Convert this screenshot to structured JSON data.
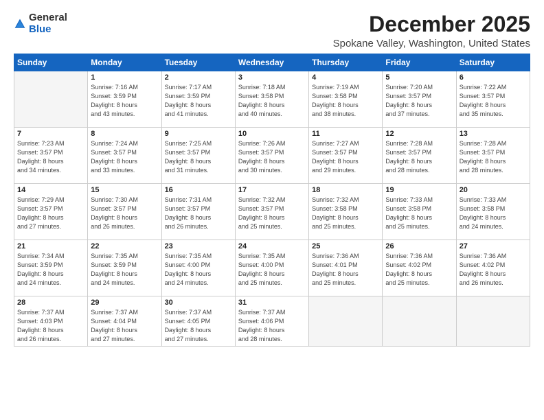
{
  "header": {
    "logo_general": "General",
    "logo_blue": "Blue",
    "month_title": "December 2025",
    "location": "Spokane Valley, Washington, United States"
  },
  "days_of_week": [
    "Sunday",
    "Monday",
    "Tuesday",
    "Wednesday",
    "Thursday",
    "Friday",
    "Saturday"
  ],
  "weeks": [
    [
      {
        "day": "",
        "info": ""
      },
      {
        "day": "1",
        "info": "Sunrise: 7:16 AM\nSunset: 3:59 PM\nDaylight: 8 hours\nand 43 minutes."
      },
      {
        "day": "2",
        "info": "Sunrise: 7:17 AM\nSunset: 3:59 PM\nDaylight: 8 hours\nand 41 minutes."
      },
      {
        "day": "3",
        "info": "Sunrise: 7:18 AM\nSunset: 3:58 PM\nDaylight: 8 hours\nand 40 minutes."
      },
      {
        "day": "4",
        "info": "Sunrise: 7:19 AM\nSunset: 3:58 PM\nDaylight: 8 hours\nand 38 minutes."
      },
      {
        "day": "5",
        "info": "Sunrise: 7:20 AM\nSunset: 3:57 PM\nDaylight: 8 hours\nand 37 minutes."
      },
      {
        "day": "6",
        "info": "Sunrise: 7:22 AM\nSunset: 3:57 PM\nDaylight: 8 hours\nand 35 minutes."
      }
    ],
    [
      {
        "day": "7",
        "info": "Sunrise: 7:23 AM\nSunset: 3:57 PM\nDaylight: 8 hours\nand 34 minutes."
      },
      {
        "day": "8",
        "info": "Sunrise: 7:24 AM\nSunset: 3:57 PM\nDaylight: 8 hours\nand 33 minutes."
      },
      {
        "day": "9",
        "info": "Sunrise: 7:25 AM\nSunset: 3:57 PM\nDaylight: 8 hours\nand 31 minutes."
      },
      {
        "day": "10",
        "info": "Sunrise: 7:26 AM\nSunset: 3:57 PM\nDaylight: 8 hours\nand 30 minutes."
      },
      {
        "day": "11",
        "info": "Sunrise: 7:27 AM\nSunset: 3:57 PM\nDaylight: 8 hours\nand 29 minutes."
      },
      {
        "day": "12",
        "info": "Sunrise: 7:28 AM\nSunset: 3:57 PM\nDaylight: 8 hours\nand 28 minutes."
      },
      {
        "day": "13",
        "info": "Sunrise: 7:28 AM\nSunset: 3:57 PM\nDaylight: 8 hours\nand 28 minutes."
      }
    ],
    [
      {
        "day": "14",
        "info": "Sunrise: 7:29 AM\nSunset: 3:57 PM\nDaylight: 8 hours\nand 27 minutes."
      },
      {
        "day": "15",
        "info": "Sunrise: 7:30 AM\nSunset: 3:57 PM\nDaylight: 8 hours\nand 26 minutes."
      },
      {
        "day": "16",
        "info": "Sunrise: 7:31 AM\nSunset: 3:57 PM\nDaylight: 8 hours\nand 26 minutes."
      },
      {
        "day": "17",
        "info": "Sunrise: 7:32 AM\nSunset: 3:57 PM\nDaylight: 8 hours\nand 25 minutes."
      },
      {
        "day": "18",
        "info": "Sunrise: 7:32 AM\nSunset: 3:58 PM\nDaylight: 8 hours\nand 25 minutes."
      },
      {
        "day": "19",
        "info": "Sunrise: 7:33 AM\nSunset: 3:58 PM\nDaylight: 8 hours\nand 25 minutes."
      },
      {
        "day": "20",
        "info": "Sunrise: 7:33 AM\nSunset: 3:58 PM\nDaylight: 8 hours\nand 24 minutes."
      }
    ],
    [
      {
        "day": "21",
        "info": "Sunrise: 7:34 AM\nSunset: 3:59 PM\nDaylight: 8 hours\nand 24 minutes."
      },
      {
        "day": "22",
        "info": "Sunrise: 7:35 AM\nSunset: 3:59 PM\nDaylight: 8 hours\nand 24 minutes."
      },
      {
        "day": "23",
        "info": "Sunrise: 7:35 AM\nSunset: 4:00 PM\nDaylight: 8 hours\nand 24 minutes."
      },
      {
        "day": "24",
        "info": "Sunrise: 7:35 AM\nSunset: 4:00 PM\nDaylight: 8 hours\nand 25 minutes."
      },
      {
        "day": "25",
        "info": "Sunrise: 7:36 AM\nSunset: 4:01 PM\nDaylight: 8 hours\nand 25 minutes."
      },
      {
        "day": "26",
        "info": "Sunrise: 7:36 AM\nSunset: 4:02 PM\nDaylight: 8 hours\nand 25 minutes."
      },
      {
        "day": "27",
        "info": "Sunrise: 7:36 AM\nSunset: 4:02 PM\nDaylight: 8 hours\nand 26 minutes."
      }
    ],
    [
      {
        "day": "28",
        "info": "Sunrise: 7:37 AM\nSunset: 4:03 PM\nDaylight: 8 hours\nand 26 minutes."
      },
      {
        "day": "29",
        "info": "Sunrise: 7:37 AM\nSunset: 4:04 PM\nDaylight: 8 hours\nand 27 minutes."
      },
      {
        "day": "30",
        "info": "Sunrise: 7:37 AM\nSunset: 4:05 PM\nDaylight: 8 hours\nand 27 minutes."
      },
      {
        "day": "31",
        "info": "Sunrise: 7:37 AM\nSunset: 4:06 PM\nDaylight: 8 hours\nand 28 minutes."
      },
      {
        "day": "",
        "info": ""
      },
      {
        "day": "",
        "info": ""
      },
      {
        "day": "",
        "info": ""
      }
    ]
  ]
}
